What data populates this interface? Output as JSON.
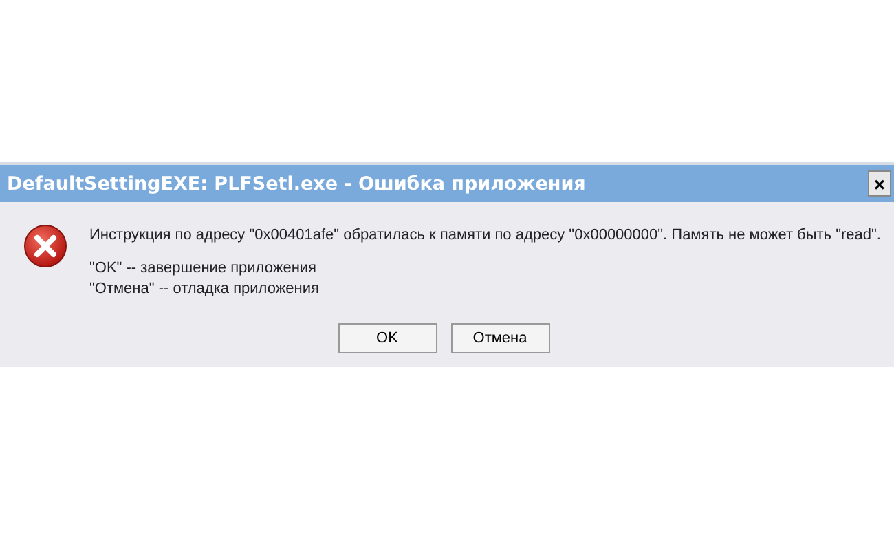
{
  "window": {
    "title": "DefaultSettingEXE: PLFSetl.exe - Ошибка приложения",
    "close": "×"
  },
  "message": "Инструкция по адресу \"0x00401afe\" обратилась к памяти по адресу \"0x00000000\". Память не может быть \"read\".",
  "notes": [
    "\"OK\" -- завершение приложения",
    "\"Отмена\" -- отладка приложения"
  ],
  "buttons": [
    "OK",
    "Отмена"
  ]
}
